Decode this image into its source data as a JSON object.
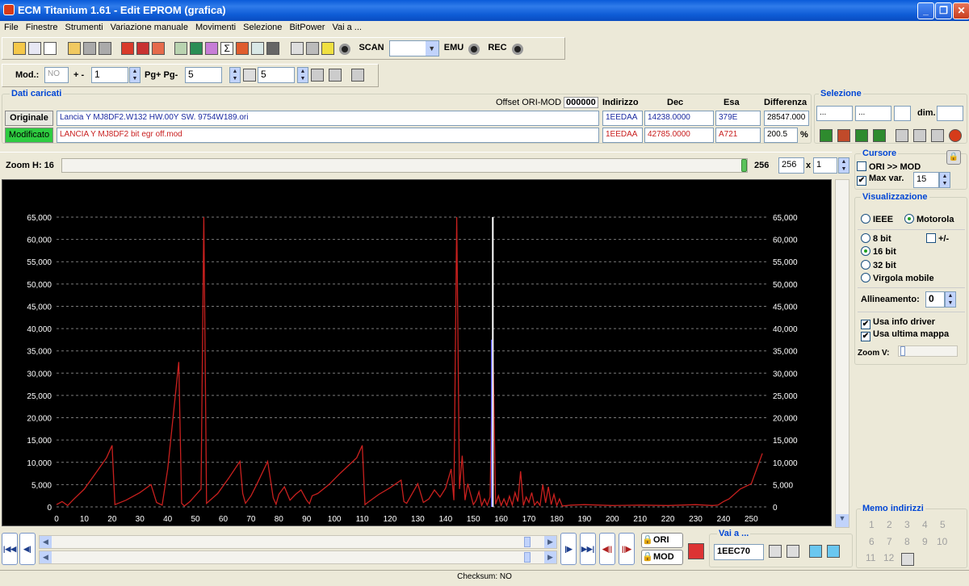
{
  "window": {
    "title": "ECM Titanium 1.61 - Edit EPROM (grafica)"
  },
  "menu": [
    "File",
    "Finestre",
    "Strumenti",
    "Variazione manuale",
    "Movimenti",
    "Selezione",
    "BitPower",
    "Vai a ..."
  ],
  "toolbar1": {
    "scan_label": "SCAN",
    "emu_label": "EMU",
    "rec_label": "REC",
    "scan_value": ""
  },
  "toolbar2": {
    "mod_label": "Mod.:",
    "mod_value": "NO",
    "plusminus_label": "+ -",
    "plusminus_value": "1",
    "pg_label": "Pg+ Pg-",
    "pg_value": "5",
    "p_value": "5"
  },
  "dati": {
    "section_title": "Dati caricati",
    "offset_label": "Offset ORI-MOD",
    "offset_value": "000000",
    "col_indirizzo": "Indirizzo",
    "col_dec": "Dec",
    "col_esa": "Esa",
    "col_diff": "Differenza",
    "originale_label": "Originale",
    "originale_file": "Lancia Y MJ8DF2.W132 HW.00Y SW. 9754W189.ori",
    "originale_indirizzo": "1EEDAA",
    "originale_dec": "14238.0000",
    "originale_esa": "379E",
    "diff_value": "28547.000",
    "modificato_label": "Modificato",
    "modificato_file": "LANCIA Y MJ8DF2 bit egr off.mod",
    "modificato_indirizzo": "1EEDAA",
    "modificato_dec": "42785.0000",
    "modificato_esa": "A721",
    "diff_percent": "200.5",
    "percent_sign": "%"
  },
  "selezione": {
    "title": "Selezione",
    "field1": "...",
    "field2": "...",
    "dim_label": "dim."
  },
  "zoom": {
    "label": "Zoom H: 16",
    "value": "256",
    "field": "256",
    "x_sign": "x",
    "mult": "1"
  },
  "cursore": {
    "title": "Cursore",
    "ori_mod": "ORI >> MOD",
    "max_var": "Max var.",
    "max_var_value": "15"
  },
  "visualizzazione": {
    "title": "Visualizzazione",
    "ieee": "IEEE",
    "motorola": "Motorola",
    "bit8": "8 bit",
    "plusminus": "+/-",
    "bit16": "16 bit",
    "bit32": "32 bit",
    "virgola": "Virgola mobile",
    "allineamento": "Allineamento:",
    "allineamento_value": "0",
    "usa_info": "Usa info driver",
    "usa_ultima": "Usa ultima mappa",
    "zoom_v": "Zoom V:"
  },
  "memo": {
    "title": "Memo indirizzi",
    "numbers": [
      "1",
      "2",
      "3",
      "4",
      "5",
      "6",
      "7",
      "8",
      "9",
      "10",
      "11",
      "12"
    ]
  },
  "nav": {
    "ori_label": "ORI",
    "mod_label": "MOD",
    "vai_title": "Vai a ...",
    "vai_value": "1EEC70"
  },
  "status": {
    "checksum": "Checksum: NO"
  },
  "chart_data": {
    "type": "line",
    "xlim": [
      0,
      256
    ],
    "ylim": [
      0,
      65000
    ],
    "x_ticks": [
      0,
      10,
      20,
      30,
      40,
      50,
      60,
      70,
      80,
      90,
      100,
      110,
      120,
      130,
      140,
      150,
      160,
      170,
      180,
      190,
      200,
      210,
      220,
      230,
      240,
      250
    ],
    "y_ticks": [
      0,
      5000,
      10000,
      15000,
      20000,
      25000,
      30000,
      35000,
      40000,
      45000,
      50000,
      55000,
      60000,
      65000
    ],
    "y_tick_labels": [
      "0",
      "5,000",
      "10,000",
      "15,000",
      "20,000",
      "25,000",
      "30,000",
      "35,000",
      "40,000",
      "45,000",
      "50,000",
      "55,000",
      "60,000",
      "65,000"
    ],
    "grid": true,
    "cursor_x": 157,
    "cursor_y": 65000,
    "cursor_ori_y": 37500,
    "series": [
      {
        "color": "#C8201E",
        "x": [
          0,
          2,
          4,
          6,
          10,
          14,
          18,
          20,
          21,
          25,
          30,
          34,
          36,
          38,
          40,
          44,
          45,
          46,
          48,
          52,
          53,
          54,
          58,
          62,
          66,
          67,
          68,
          70,
          72,
          76,
          78,
          79,
          80,
          82,
          84,
          86,
          88,
          90,
          91,
          92,
          94,
          98,
          102,
          108,
          110,
          111,
          112,
          116,
          120,
          124,
          125,
          126,
          128,
          130,
          132,
          134,
          136,
          138,
          140,
          142,
          143,
          144,
          145,
          146,
          147,
          148,
          150,
          151,
          152,
          153,
          154,
          155,
          156,
          157,
          158,
          159,
          160,
          161,
          162,
          163,
          164,
          165,
          166,
          167,
          168,
          169,
          170,
          171,
          172,
          173,
          174,
          175,
          176,
          177,
          178,
          179,
          180,
          181,
          182,
          185,
          190,
          200,
          210,
          220,
          230,
          236,
          238,
          240,
          242,
          246,
          250,
          254
        ],
        "y": [
          500,
          1200,
          300,
          1600,
          4000,
          7500,
          11000,
          13800,
          500,
          1500,
          3200,
          5000,
          1000,
          400,
          8500,
          32500,
          800,
          200,
          1200,
          4000,
          65000,
          800,
          3000,
          6500,
          10200,
          3000,
          800,
          2500,
          5000,
          10200,
          2000,
          600,
          2800,
          4500,
          1500,
          2800,
          3800,
          1500,
          700,
          2500,
          3000,
          5000,
          7500,
          11000,
          13800,
          500,
          1000,
          2800,
          4300,
          6000,
          1200,
          800,
          3000,
          5200,
          1000,
          1800,
          3800,
          2200,
          4200,
          8500,
          1500,
          65000,
          4000,
          11500,
          1500,
          5200,
          500,
          1500,
          3400,
          300,
          1800,
          400,
          2200,
          37500,
          600,
          2500,
          300,
          1800,
          300,
          2400,
          400,
          3200,
          1200,
          8000,
          300,
          2200,
          1000,
          3200,
          400,
          1200,
          300,
          5000,
          900,
          4500,
          500,
          2800,
          300,
          1800,
          200,
          400,
          500,
          300,
          400,
          300,
          500,
          300,
          400,
          1200,
          1800,
          4000,
          5200,
          12000
        ]
      }
    ]
  }
}
